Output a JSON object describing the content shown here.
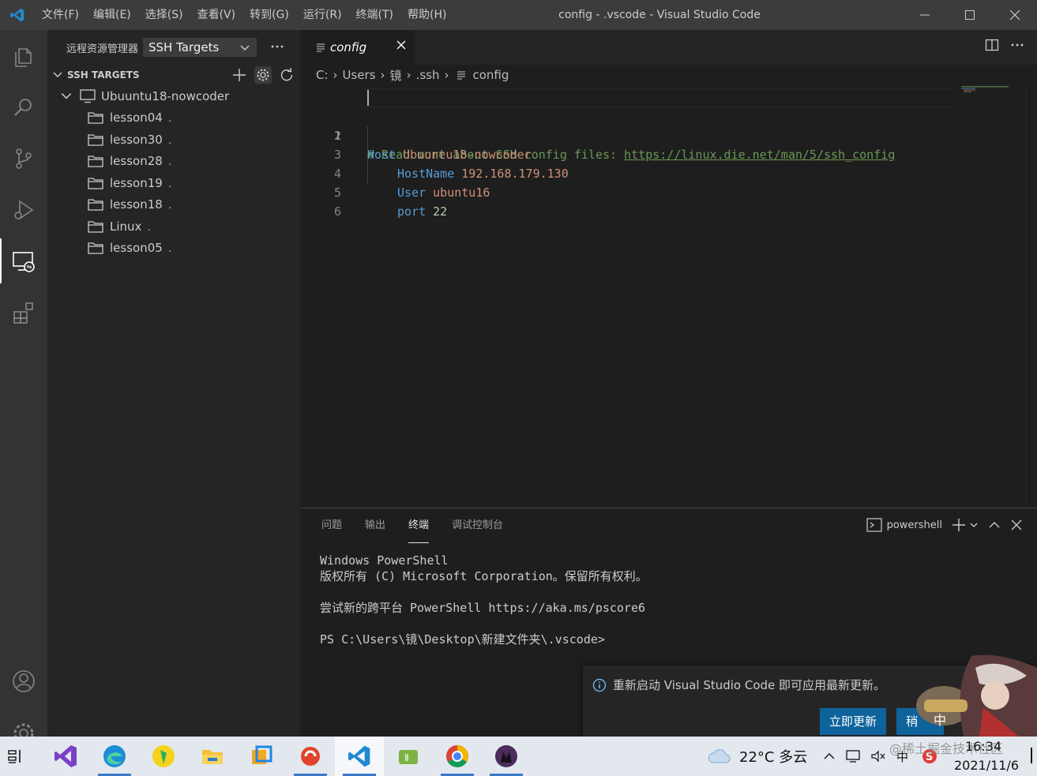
{
  "window": {
    "title": "config - .vscode - Visual Studio Code",
    "menu": [
      "文件(F)",
      "编辑(E)",
      "选择(S)",
      "查看(V)",
      "转到(G)",
      "运行(R)",
      "终端(T)",
      "帮助(H)"
    ]
  },
  "sidebar": {
    "title": "远程资源管理器",
    "select_value": "SSH Targets",
    "section_title": "SSH TARGETS",
    "host": "Ubuuntu18-nowcoder",
    "folders": [
      "lesson04",
      "lesson30",
      "lesson28",
      "lesson19",
      "lesson18",
      "Linux",
      "lesson05"
    ],
    "folder_suffix": "."
  },
  "editor": {
    "tab_label": "config",
    "breadcrumb": [
      "C:",
      "Users",
      "镜",
      ".ssh",
      "config"
    ],
    "line_numbers": [
      "1",
      "2",
      "3",
      "4",
      "5",
      "6"
    ],
    "lines": {
      "l1_comment": "# Read more about SSH config files: ",
      "l1_link": "https://linux.die.net/man/5/ssh_config",
      "l2_kw": "Host",
      "l2_val": " Ubuuntu18-nowcoder",
      "l3_kw": "HostName",
      "l3_val": " 192.168.179.130",
      "l4_kw": "User",
      "l4_val": " ubuntu16",
      "l5_kw": "port",
      "l5_val": " 22"
    }
  },
  "panel": {
    "tabs": [
      "问题",
      "输出",
      "终端",
      "调试控制台"
    ],
    "active_tab": "终端",
    "terminal_name": "powershell",
    "terminal_lines": [
      "Windows PowerShell",
      "版权所有 (C) Microsoft Corporation。保留所有权利。",
      "",
      "尝试新的跨平台 PowerShell https://aka.ms/pscore6",
      "",
      "PS C:\\Users\\镜\\Desktop\\新建文件夹\\.vscode>"
    ]
  },
  "notification": {
    "message": "重新启动 Visual Studio Code 即可应用最新更新。",
    "primary_button": "立即更新",
    "secondary_button": "稍"
  },
  "taskbar": {
    "weather": "22°C 多云",
    "time": "16:34",
    "date": "2021/11/6",
    "ime": "中",
    "watermark": "@稀土掘金技术社区"
  },
  "colors": {
    "accent": "#0e639c",
    "comment": "#6a9955",
    "keyword": "#569cd6",
    "string": "#ce9178",
    "number": "#b5cea8"
  }
}
